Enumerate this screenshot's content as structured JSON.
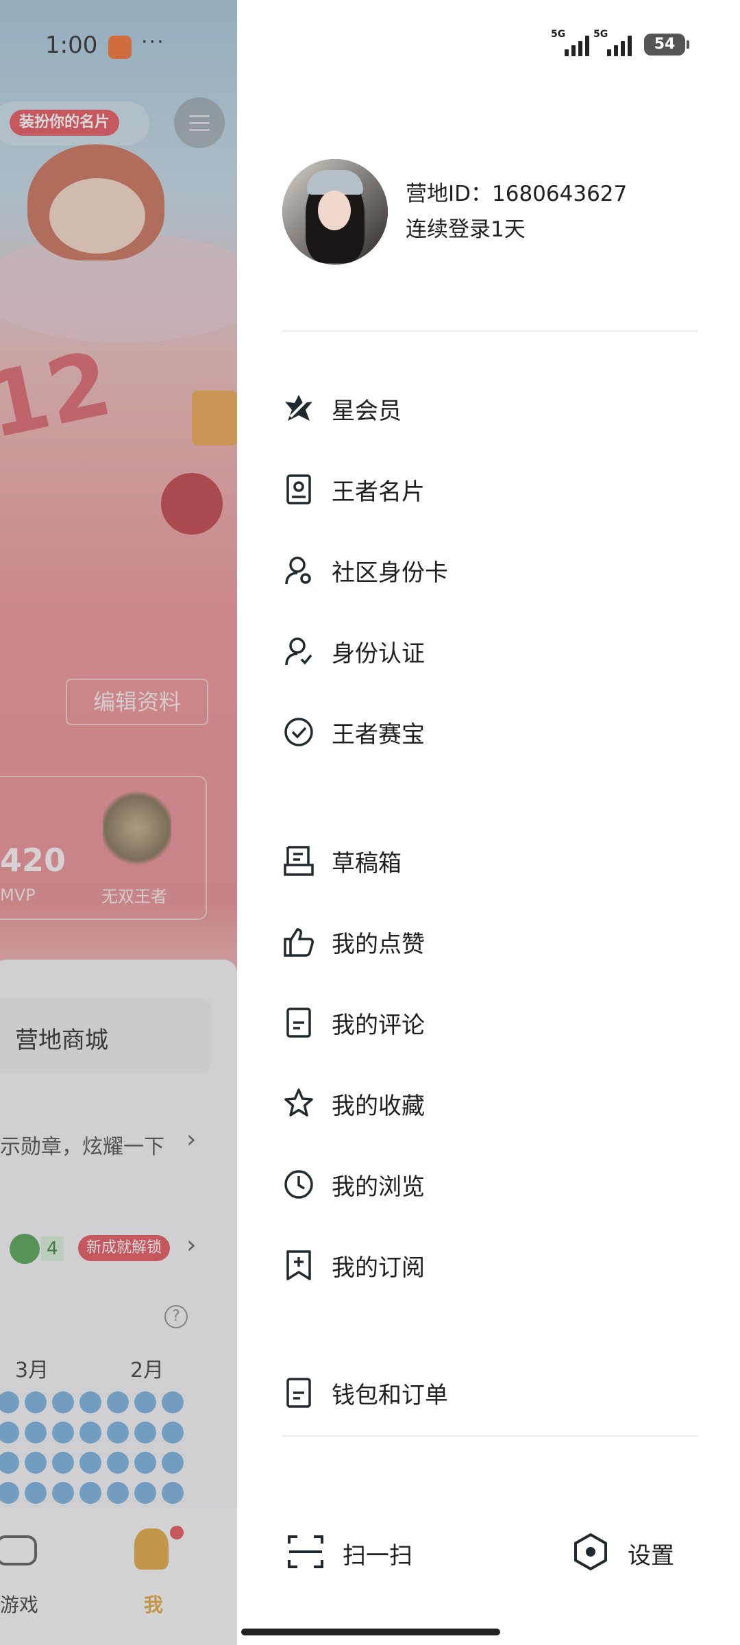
{
  "background_app": {
    "status": {
      "time": "1:00",
      "more": "···"
    },
    "dress_up_tag": "装扮你的名片",
    "big_number": "12",
    "edit_profile": "编辑资料",
    "stats": {
      "value": "420",
      "label": "MVP"
    },
    "rank": "无双王者",
    "shop": "营地商城",
    "medal_hint": "示勋章，炫耀一下",
    "achievement": {
      "count": "4",
      "tag": "新成就解锁"
    },
    "help": "?",
    "months": [
      "3月",
      "2月"
    ],
    "nav": {
      "game": "游戏",
      "me": "我"
    }
  },
  "status_bar": {
    "network_1": "5G",
    "network_2": "5G",
    "battery": "54"
  },
  "profile": {
    "uid": "营地ID：1680643627",
    "streak": "连续登录1天"
  },
  "menu_group_1": [
    {
      "label": "星会员",
      "icon": "star-member-icon"
    },
    {
      "label": "王者名片",
      "icon": "name-card-icon"
    },
    {
      "label": "社区身份卡",
      "icon": "community-id-icon"
    },
    {
      "label": "身份认证",
      "icon": "verify-identity-icon"
    },
    {
      "label": "王者赛宝",
      "icon": "check-circle-icon"
    }
  ],
  "menu_group_2": [
    {
      "label": "草稿箱",
      "icon": "drafts-icon"
    },
    {
      "label": "我的点赞",
      "icon": "thumbs-up-icon"
    },
    {
      "label": "我的评论",
      "icon": "comment-doc-icon"
    },
    {
      "label": "我的收藏",
      "icon": "star-outline-icon"
    },
    {
      "label": "我的浏览",
      "icon": "clock-icon"
    },
    {
      "label": "我的订阅",
      "icon": "bookmark-plus-icon"
    }
  ],
  "menu_group_3": [
    {
      "label": "钱包和订单",
      "icon": "wallet-doc-icon"
    }
  ],
  "bottom": {
    "scan": "扫一扫",
    "settings": "设置"
  }
}
